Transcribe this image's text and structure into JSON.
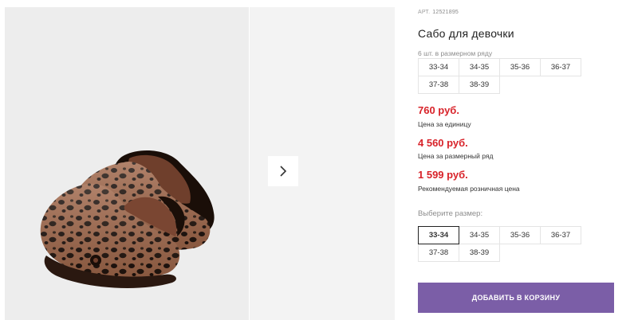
{
  "product": {
    "sku_label": "АРТ.",
    "sku": "12521895",
    "title": "Сабо для девочки",
    "pack_count": "6 шт. в размерном ряду",
    "pack_sizes": [
      "33-34",
      "34-35",
      "35-36",
      "36-37",
      "37-38",
      "38-39"
    ],
    "prices": [
      {
        "value": "760 руб.",
        "caption": "Цена за единицу"
      },
      {
        "value": "4 560 руб.",
        "caption": "Цена за размерный ряд"
      },
      {
        "value": "1 599 руб.",
        "caption": "Рекомендуемая розничная цена"
      }
    ],
    "choose_size_label": "Выберите размер:",
    "size_options": [
      "33-34",
      "34-35",
      "35-36",
      "36-37",
      "37-38",
      "38-39"
    ],
    "selected_size": "33-34",
    "add_to_cart": "ДОБАВИТЬ В КОРЗИНУ"
  },
  "gallery": {
    "next_icon": "chevron-right-icon"
  },
  "colors": {
    "price": "#d8232a",
    "button": "#7b5ea7",
    "image_bg": "#ededed"
  }
}
